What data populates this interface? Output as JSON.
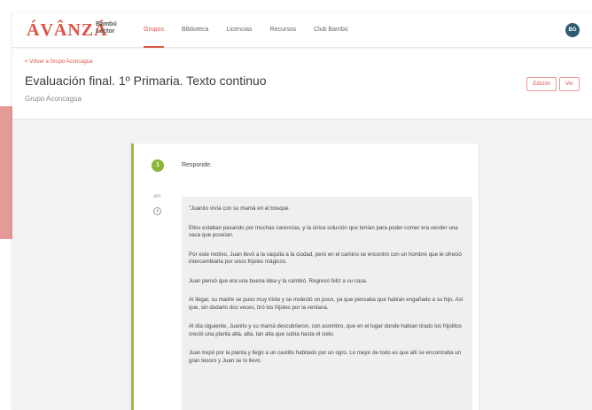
{
  "app": {
    "logo": "ÁVÂNZÁ",
    "logo_sub": "Bambú Lector"
  },
  "nav": {
    "items": [
      "Grupos",
      "Biblioteca",
      "Licencias",
      "Recursos",
      "Club Bambú"
    ],
    "active_index": 0
  },
  "user": {
    "initials": "BG"
  },
  "header": {
    "back_link": "< Volver a Grupo Aconcagua",
    "title": "Evaluación final. 1º Primaria. Texto continuo",
    "subtitle": "Grupo Aconcagua",
    "buttons": {
      "edicion": "Edición",
      "ver": "Ver"
    }
  },
  "question": {
    "step": "1",
    "side_label": "am",
    "prompt": "Responde:",
    "paragraphs": [
      "\"Juanito vivía con su mamá en el bosque.",
      "Ellos estaban pasando por muchas carencias, y la única solución que tenían para poder comer era vender una vaca que poseían.",
      "Por este motivo, Juan llevó a la vaquita a la ciudad, pero en el camino se encontró con un hombre que le ofreció intercambiarla por unos frijoles mágicos.",
      "Juan pensó que era una buena idea y la cambió. Regresó feliz a su casa.",
      "Al llegar, su madre se puso muy triste y se molestó un poco, ya que pensaba que habían engañado a su hijo. Así que, sin dudarlo dos veces, tiró los frijoles por la ventana.",
      "Al día siguiente, Juanito y su mamá descubrieron, con asombro, que en el lugar donde habían tirado los frijolitos creció una planta alta, alta, tan alta que subía hasta el cielo.",
      "Juan trepó por la planta y llegó a un castillo habitado por un ogro. Lo mejor de todo es que allí se encontraba un gran tesoro y Juan se lo llevó."
    ]
  },
  "colors": {
    "brand": "#d95545",
    "success": "#8bb534",
    "accent_strip": "#e59a97"
  }
}
